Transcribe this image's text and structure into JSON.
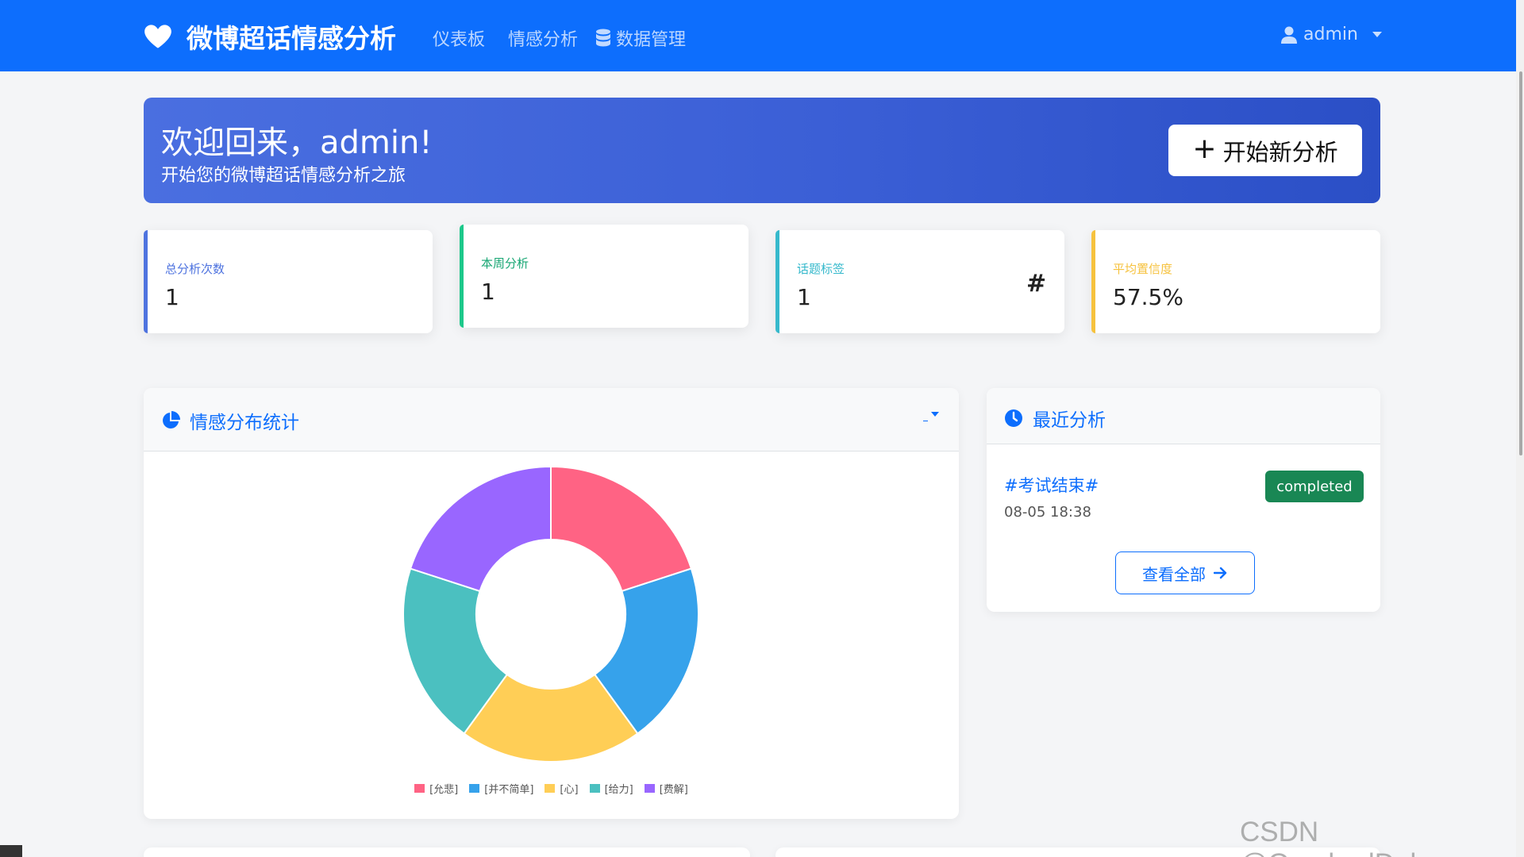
{
  "navbar": {
    "brand": "微博超话情感分析",
    "links": [
      {
        "label": "仪表板",
        "icon": null
      },
      {
        "label": "情感分析",
        "icon": null
      },
      {
        "label": "数据管理",
        "icon": "database-icon"
      }
    ],
    "user": "admin"
  },
  "hero": {
    "title": "欢迎回来，admin!",
    "subtitle": "开始您的微博超话情感分析之旅",
    "button": "开始新分析"
  },
  "stats": [
    {
      "label": "总分析次数",
      "value": "1",
      "color": "#4e73df"
    },
    {
      "label": "本周分析",
      "value": "1",
      "color": "#1cc88a"
    },
    {
      "label": "话题标签",
      "value": "1",
      "color": "#36b9cc",
      "icon": "#"
    },
    {
      "label": "平均置信度",
      "value": "57.5%",
      "color": "#f6c23e"
    }
  ],
  "sentiment_panel": {
    "title": "情感分布统计",
    "icon": "pie-chart-icon"
  },
  "chart_data": {
    "type": "pie",
    "categories": [
      "[允悲]",
      "[并不简单]",
      "[心]",
      "[给力]",
      "[费解]"
    ],
    "values": [
      1,
      1,
      1,
      1,
      1
    ],
    "colors": [
      "#ff6384",
      "#36a2eb",
      "#ffce56",
      "#4bc0c0",
      "#9966ff"
    ],
    "donut": true,
    "legend": "bottom"
  },
  "recent_panel": {
    "title": "最近分析",
    "icon": "clock-icon",
    "items": [
      {
        "topic": "#考试结束#",
        "time": "08-05 18:38",
        "status": "completed"
      }
    ],
    "view_all": "查看全部"
  },
  "watermark": "CSDN @OverlordDuke"
}
